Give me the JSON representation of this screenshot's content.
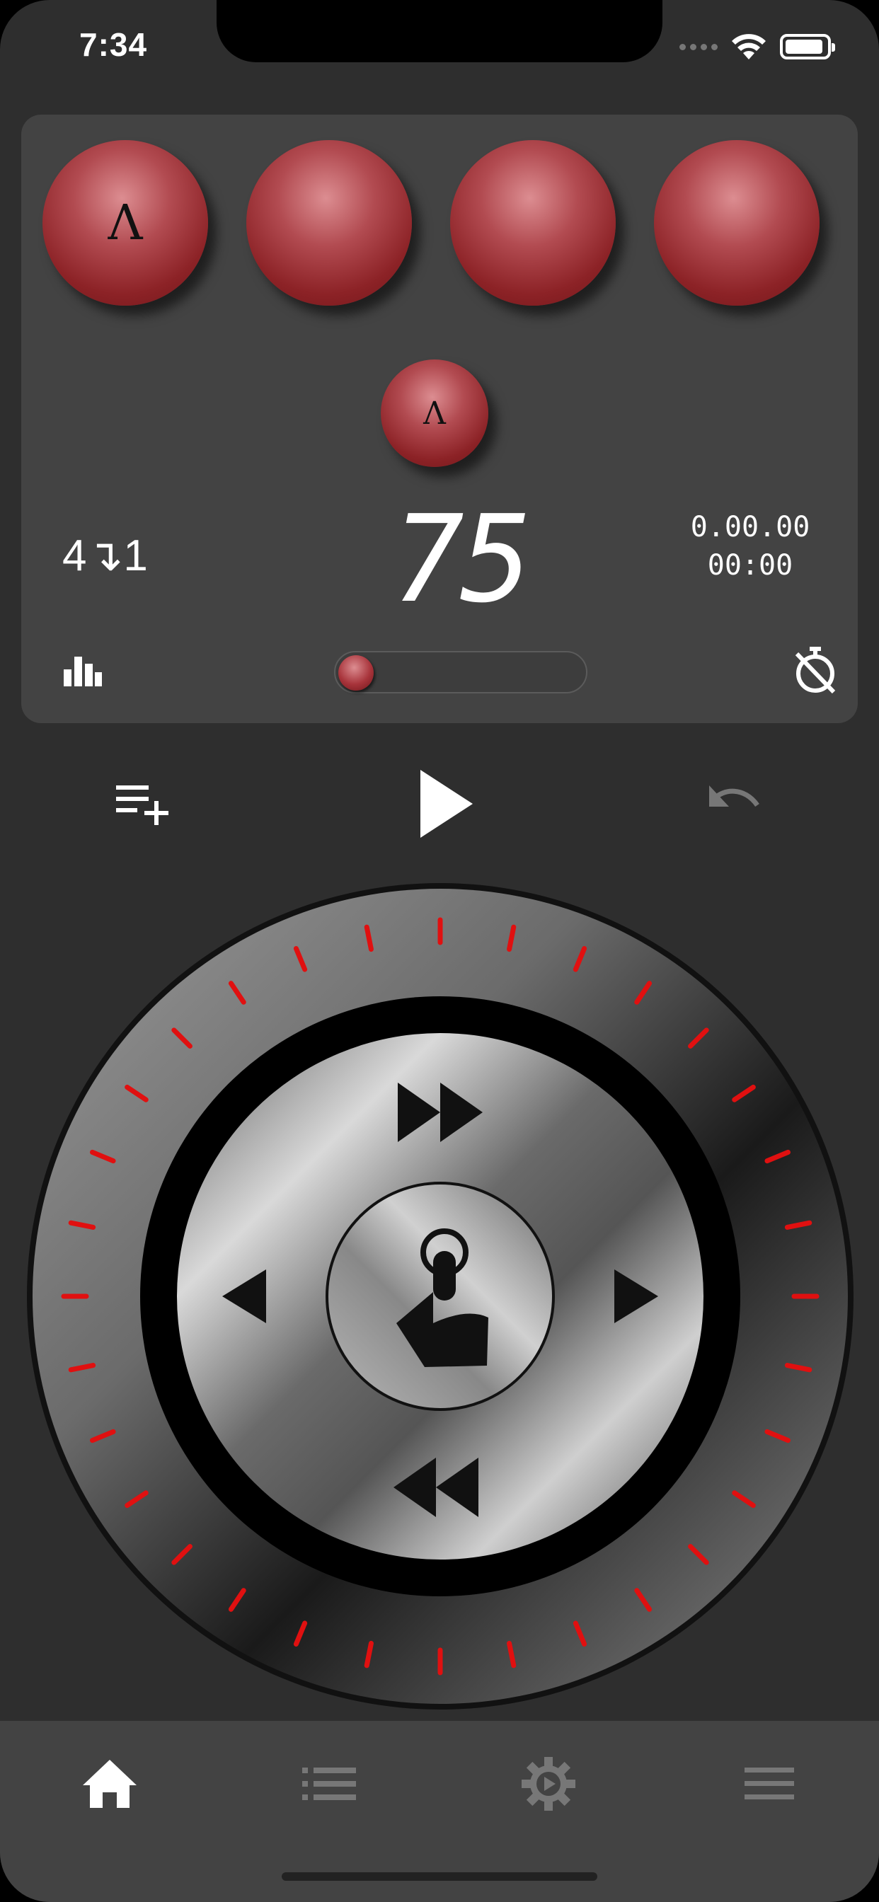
{
  "status_bar": {
    "time": "7:34"
  },
  "panel": {
    "beat_balls": [
      {
        "glyph": "Λ"
      },
      {
        "glyph": ""
      },
      {
        "glyph": ""
      },
      {
        "glyph": ""
      }
    ],
    "current_ball_glyph": "Λ",
    "ratio": "4↴1",
    "bpm": "75",
    "elapsed_counter": "0.00.00",
    "time_counter": "00:00",
    "slider_value": 0
  },
  "icons": {
    "stats": "bar-chart-icon",
    "timer_off": "timer-off-icon",
    "add_to_queue": "playlist-add-icon",
    "play": "play-icon",
    "undo": "undo-icon",
    "dial_tap": "touch-icon"
  },
  "colors": {
    "accent_red": "#e01010",
    "ball_red": "#a8343b",
    "panel_bg": "#434343",
    "screen_bg": "#2e2e2e"
  },
  "tabbar": {
    "tabs": [
      {
        "name": "home",
        "icon": "home-icon",
        "active": true
      },
      {
        "name": "list",
        "icon": "list-icon",
        "active": false
      },
      {
        "name": "settings",
        "icon": "settings-play-icon",
        "active": false
      },
      {
        "name": "menu",
        "icon": "menu-icon",
        "active": false
      }
    ]
  }
}
